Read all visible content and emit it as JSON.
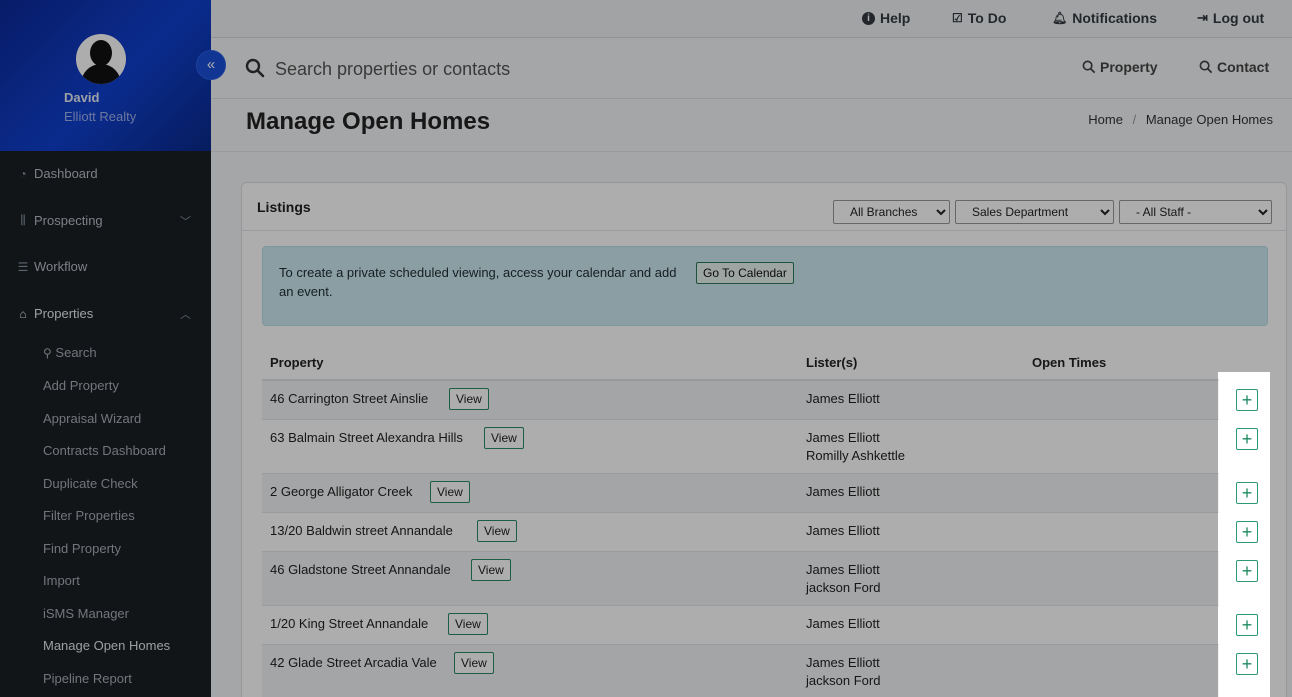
{
  "sidebar": {
    "user_name": "David",
    "user_org": "Elliott Realty",
    "collapse_icon": "«",
    "nav": [
      {
        "label": "Dashboard",
        "icon": "dashboard-icon"
      },
      {
        "label": "Prospecting",
        "icon": "prospecting-icon"
      },
      {
        "label": "Workflow",
        "icon": "workflow-icon"
      },
      {
        "label": "Properties",
        "icon": "home-icon"
      }
    ],
    "sub_items": [
      "Search",
      "Add Property",
      "Appraisal Wizard",
      "Contracts Dashboard",
      "Duplicate Check",
      "Filter Properties",
      "Find Property",
      "Import",
      "iSMS Manager",
      "Manage Open Homes",
      "Pipeline Report"
    ]
  },
  "topbar": {
    "help": "Help",
    "todo": "To Do",
    "notifications": "Notifications",
    "logout": "Log out"
  },
  "search": {
    "placeholder": "Search properties or contacts",
    "property_link": "Property",
    "contact_link": "Contact"
  },
  "page": {
    "title": "Manage Open Homes",
    "breadcrumb_home": "Home",
    "breadcrumb_sep": "/",
    "breadcrumb_current": "Manage Open Homes"
  },
  "card": {
    "title": "Listings",
    "filters": {
      "branch": "All Branches",
      "department": "Sales Department",
      "staff": "- All Staff -"
    },
    "alert_text": "To create a private scheduled viewing, access your calendar and add an event.",
    "calendar_button": "Go To Calendar",
    "columns": {
      "property": "Property",
      "listers": "Lister(s)",
      "open_times": "Open Times"
    },
    "view_label": "View",
    "add_label": "+",
    "rows": [
      {
        "address": "46 Carrington Street Ainslie",
        "listers": [
          "James Elliott"
        ]
      },
      {
        "address": "63 Balmain Street Alexandra Hills",
        "listers": [
          "James Elliott",
          "Romilly Ashkettle"
        ]
      },
      {
        "address": "2 George Alligator Creek",
        "listers": [
          "James Elliott"
        ]
      },
      {
        "address": "13/20 Baldwin street Annandale",
        "listers": [
          "James Elliott"
        ]
      },
      {
        "address": "46 Gladstone Street Annandale",
        "listers": [
          "James Elliott",
          "jackson Ford"
        ]
      },
      {
        "address": "1/20 King Street Annandale",
        "listers": [
          "James Elliott"
        ]
      },
      {
        "address": "42 Glade Street Arcadia Vale",
        "listers": [
          "James Elliott",
          "jackson Ford"
        ]
      }
    ]
  },
  "colors": {
    "sidebar_bg": "#1b1f24",
    "profile_bg": "#1040d0",
    "accent_green": "#2b9a70",
    "alert_bg": "#cde9f1"
  }
}
